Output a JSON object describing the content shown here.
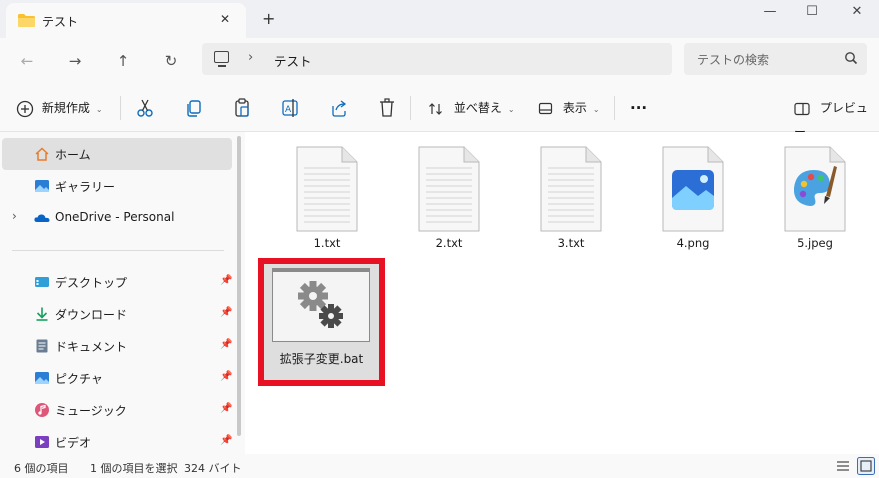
{
  "tab": {
    "title": "テスト",
    "close_glyph": "✕"
  },
  "window": {
    "new_tab_glyph": "+",
    "minimize_glyph": "—",
    "maximize_glyph": "☐",
    "close_glyph": "✕"
  },
  "nav": {
    "back_glyph": "←",
    "forward_glyph": "→",
    "up_glyph": "↑",
    "refresh_glyph": "↻"
  },
  "address": {
    "separator": "›",
    "breadcrumb": "テスト"
  },
  "search": {
    "placeholder": "テストの検索"
  },
  "command_bar": {
    "new_label": "新規作成",
    "sort_label": "並べ替え",
    "view_label": "表示",
    "more_glyph": "···",
    "preview_label": "プレビュー"
  },
  "sidebar": {
    "items": [
      {
        "label": "ホーム",
        "icon": "home-icon"
      },
      {
        "label": "ギャラリー",
        "icon": "gallery-icon"
      },
      {
        "label": "OneDrive - Personal",
        "icon": "onedrive-icon",
        "expand_glyph": "›"
      }
    ],
    "quick_access": [
      {
        "label": "デスクトップ",
        "icon": "desktop-icon"
      },
      {
        "label": "ダウンロード",
        "icon": "download-icon"
      },
      {
        "label": "ドキュメント",
        "icon": "document-icon"
      },
      {
        "label": "ピクチャ",
        "icon": "pictures-icon"
      },
      {
        "label": "ミュージック",
        "icon": "music-icon"
      },
      {
        "label": "ビデオ",
        "icon": "video-icon"
      }
    ],
    "pin_glyph": "📌"
  },
  "files": [
    {
      "name": "1.txt",
      "icon": "text-file-icon"
    },
    {
      "name": "2.txt",
      "icon": "text-file-icon"
    },
    {
      "name": "3.txt",
      "icon": "text-file-icon"
    },
    {
      "name": "4.png",
      "icon": "image-file-icon"
    },
    {
      "name": "5.jpeg",
      "icon": "paint-file-icon"
    },
    {
      "name": "拡張子変更.bat",
      "icon": "batch-file-icon",
      "selected": true
    }
  ],
  "status": {
    "item_count": "6 個の項目",
    "selection": "1 個の項目を選択",
    "size": "324 バイト"
  },
  "colors": {
    "highlight_border": "#e81123",
    "folder": "#f8c12d",
    "accent": "#0f6cbd"
  }
}
